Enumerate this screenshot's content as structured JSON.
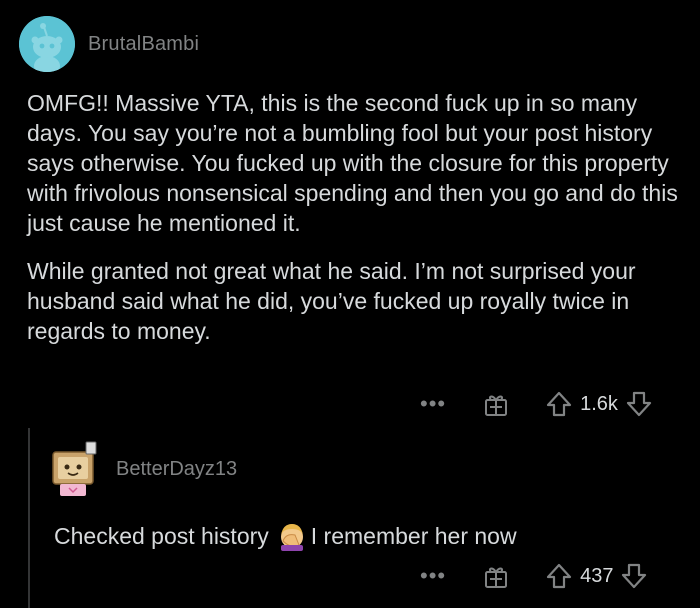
{
  "comment": {
    "username": "BrutalBambi",
    "paragraphs": [
      "OMFG!! Massive YTA, this is the second fuck up in so many days. You say you’re not a bumbling fool but your post history says otherwise. You fucked up with the closure for this property with frivolous nonsensical spending and then you go and do this just cause he mentioned it.",
      "While granted not great what he said. I’m not surprised your husband said what he did, you’ve fucked up royally twice in regards to money."
    ],
    "more_icon": "more-dots-icon",
    "award_icon": "award-gift-icon",
    "score": "1.6k"
  },
  "reply": {
    "username": "BetterDayz13",
    "text_before": "Checked post history",
    "emoji": "facepalm-emoji",
    "text_after": "I remember her now",
    "score": "437"
  },
  "colors": {
    "background": "#000000",
    "text": "#d7dadc",
    "meta": "#818384",
    "avatar": "#5bc3d4"
  }
}
